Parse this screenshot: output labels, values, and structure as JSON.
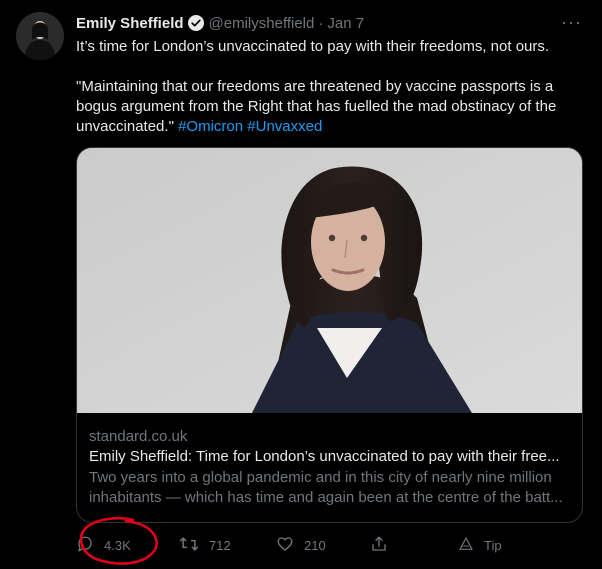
{
  "tweet": {
    "author": {
      "name": "Emily Sheffield",
      "handle": "@emilysheffield",
      "date": "Jan 7"
    },
    "text_line1": "It’s time for London’s unvaccinated to pay with their freedoms, not ours.",
    "text_quote": "\"Maintaining that our freedoms are threatened by vaccine passports is a bogus argument from the Right that has fuelled the mad obstinacy of the unvaccinated.\"",
    "hashtags": [
      "#Omicron",
      "#Unvaxxed"
    ],
    "more_label": "···"
  },
  "card": {
    "domain": "standard.co.uk",
    "title": "Emily Sheffield: Time for London’s unvaccinated to pay with their free...",
    "description_line1": "Two years into a global pandemic and in this city of nearly nine million",
    "description_line2": "inhabitants — which has time and again been at the centre of the batt..."
  },
  "actions": {
    "reply": {
      "icon": "reply-icon",
      "count": "4.3K"
    },
    "retweet": {
      "icon": "retweet-icon",
      "count": "712"
    },
    "like": {
      "icon": "heart-icon",
      "count": "210"
    },
    "share": {
      "icon": "share-icon",
      "count": ""
    },
    "tip": {
      "icon": "tip-icon",
      "label": "Tip"
    }
  },
  "colors": {
    "background": "#000000",
    "text": "#e7e9ea",
    "secondary": "#71767b",
    "link": "#1d9bf0",
    "annotation": "#e0001b"
  }
}
